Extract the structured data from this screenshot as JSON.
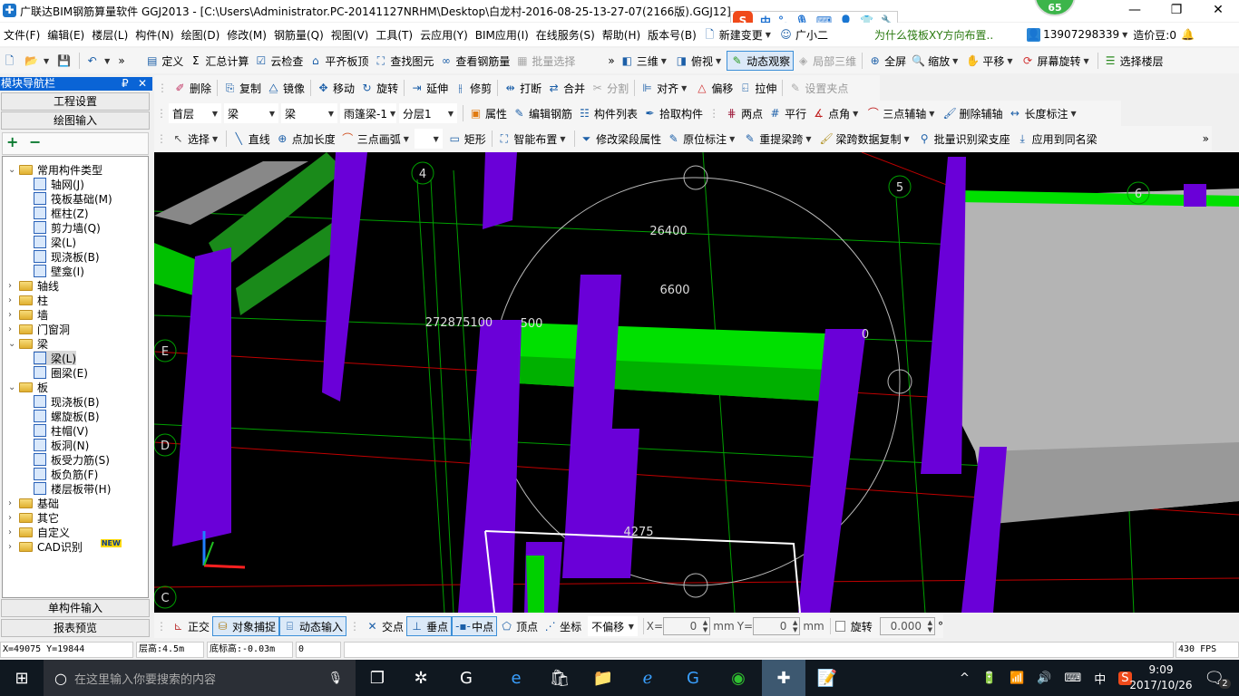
{
  "window": {
    "title": "广联达BIM钢筋算量软件 GGJ2013 - [C:\\Users\\Administrator.PC-20141127NRHM\\Desktop\\白龙村-2016-08-25-13-27-07(2166版).GGJ12]",
    "badge": "65",
    "minimize": "—",
    "restore": "❐",
    "close": "✕"
  },
  "menu": {
    "items": [
      "文件(F)",
      "编辑(E)",
      "楼层(L)",
      "构件(N)",
      "绘图(D)",
      "修改(M)",
      "钢筋量(Q)",
      "视图(V)",
      "工具(T)",
      "云应用(Y)",
      "BIM应用(I)",
      "在线服务(S)",
      "帮助(H)",
      "版本号(B)"
    ],
    "new_change": "新建变更",
    "guangxiaoer": "广小二",
    "tip_link": "为什么筏板XY方向布置..",
    "account": "13907298339",
    "beans": "造价豆:0"
  },
  "ime": {
    "logo": "S",
    "lang": "中",
    "punct": "°,"
  },
  "toolbar1": {
    "define": "定义",
    "sum": "汇总计算",
    "cloud_check": "云检查",
    "align_top": "平齐板顶",
    "find": "查找图元",
    "view_rebar": "查看钢筋量",
    "batch_select": "批量选择",
    "three_d": "三维",
    "top_view": "俯视",
    "dynamic_view": "动态观察",
    "local_3d": "局部三维",
    "fullscreen": "全屏",
    "zoom": "缩放",
    "pan": "平移",
    "screen_rotate": "屏幕旋转",
    "select_floor": "选择楼层"
  },
  "toolbar2": {
    "delete": "删除",
    "copy": "复制",
    "mirror": "镜像",
    "move": "移动",
    "rotate": "旋转",
    "extend": "延伸",
    "trim": "修剪",
    "break": "打断",
    "merge": "合并",
    "split": "分割",
    "align": "对齐",
    "offset": "偏移",
    "stretch": "拉伸",
    "set_grip": "设置夹点"
  },
  "toolbar3": {
    "floor": "首层",
    "type": "梁",
    "subtype": "梁",
    "component": "雨篷梁-1",
    "layer": "分层1",
    "property": "属性",
    "edit_rebar": "编辑钢筋",
    "component_list": "构件列表",
    "pick": "拾取构件",
    "two_point": "两点",
    "parallel": "平行",
    "point_angle": "点角",
    "three_point_axis": "三点辅轴",
    "delete_axis": "删除辅轴",
    "length_dim": "长度标注"
  },
  "toolbar4": {
    "select": "选择",
    "line": "直线",
    "point_length": "点加长度",
    "arc": "三点画弧",
    "rect": "矩形",
    "smart": "智能布置",
    "modify_span": "修改梁段属性",
    "in_place": "原位标注",
    "re_span": "重提梁跨",
    "copy_span": "梁跨数据复制",
    "batch_support": "批量识别梁支座",
    "apply_same": "应用到同名梁"
  },
  "sidebar": {
    "title": "模块导航栏",
    "pin": "₽",
    "close": "✕",
    "project_settings": "工程设置",
    "drawing_input": "绘图输入",
    "expand": "+",
    "collapse": "−",
    "single_input": "单构件输入",
    "report": "报表预览",
    "tree": [
      {
        "label": "常用构件类型",
        "level": 0,
        "kind": "folder",
        "open": true
      },
      {
        "label": "轴网(J)",
        "level": 1,
        "kind": "leaf"
      },
      {
        "label": "筏板基础(M)",
        "level": 1,
        "kind": "leaf"
      },
      {
        "label": "框柱(Z)",
        "level": 1,
        "kind": "leaf"
      },
      {
        "label": "剪力墙(Q)",
        "level": 1,
        "kind": "leaf"
      },
      {
        "label": "梁(L)",
        "level": 1,
        "kind": "leaf"
      },
      {
        "label": "现浇板(B)",
        "level": 1,
        "kind": "leaf"
      },
      {
        "label": "壁龛(I)",
        "level": 1,
        "kind": "leaf"
      },
      {
        "label": "轴线",
        "level": 0,
        "kind": "folder",
        "open": false
      },
      {
        "label": "柱",
        "level": 0,
        "kind": "folder",
        "open": false
      },
      {
        "label": "墙",
        "level": 0,
        "kind": "folder",
        "open": false
      },
      {
        "label": "门窗洞",
        "level": 0,
        "kind": "folder",
        "open": false
      },
      {
        "label": "梁",
        "level": 0,
        "kind": "folder",
        "open": true
      },
      {
        "label": "梁(L)",
        "level": 1,
        "kind": "leaf",
        "selected": true
      },
      {
        "label": "圈梁(E)",
        "level": 1,
        "kind": "leaf"
      },
      {
        "label": "板",
        "level": 0,
        "kind": "folder",
        "open": true
      },
      {
        "label": "现浇板(B)",
        "level": 1,
        "kind": "leaf"
      },
      {
        "label": "螺旋板(B)",
        "level": 1,
        "kind": "leaf"
      },
      {
        "label": "柱帽(V)",
        "level": 1,
        "kind": "leaf"
      },
      {
        "label": "板洞(N)",
        "level": 1,
        "kind": "leaf"
      },
      {
        "label": "板受力筋(S)",
        "level": 1,
        "kind": "leaf"
      },
      {
        "label": "板负筋(F)",
        "level": 1,
        "kind": "leaf"
      },
      {
        "label": "楼层板带(H)",
        "level": 1,
        "kind": "leaf"
      },
      {
        "label": "基础",
        "level": 0,
        "kind": "folder",
        "open": false
      },
      {
        "label": "其它",
        "level": 0,
        "kind": "folder",
        "open": false
      },
      {
        "label": "自定义",
        "level": 0,
        "kind": "folder",
        "open": false
      },
      {
        "label": "CAD识别",
        "level": 0,
        "kind": "folder",
        "open": false,
        "badge": "NEW"
      }
    ]
  },
  "viewport": {
    "axis_labels": {
      "a4": "4",
      "a5": "5",
      "a6": "6",
      "e": "E",
      "d": "D",
      "c": "C"
    },
    "dims": {
      "d1": "26400",
      "d2": "6600",
      "d3": "4275",
      "d4": "500",
      "d5": "272875100",
      "d6": "0"
    },
    "colors": {
      "column": "#6a00d8",
      "beam": "#00e000",
      "slab": "#b4b4b4",
      "grid": "#00a000",
      "axis_red": "#c00000"
    }
  },
  "bottombar": {
    "ortho": "正交",
    "snap": "对象捕捉",
    "dyn_input": "动态输入",
    "intersect": "交点",
    "perp": "垂点",
    "mid": "中点",
    "vertex": "顶点",
    "coord": "坐标",
    "offset_mode": "不偏移",
    "x_label": "X=",
    "x_value": "0",
    "mm1": "mm",
    "y_label": "Y=",
    "y_value": "0",
    "mm2": "mm",
    "rotate_label": "旋转",
    "rotate_value": "0.000",
    "deg": "°"
  },
  "status": {
    "coords": "X=49075 Y=19844",
    "floor_height": "层高:4.5m",
    "base_elev": "底标高:-0.03m",
    "value": "0",
    "fps": "430 FPS"
  },
  "taskbar": {
    "search_placeholder": "在这里输入你要搜索的内容",
    "time": "9:09",
    "date": "2017/10/26",
    "ime": "中",
    "notifications": "2"
  }
}
